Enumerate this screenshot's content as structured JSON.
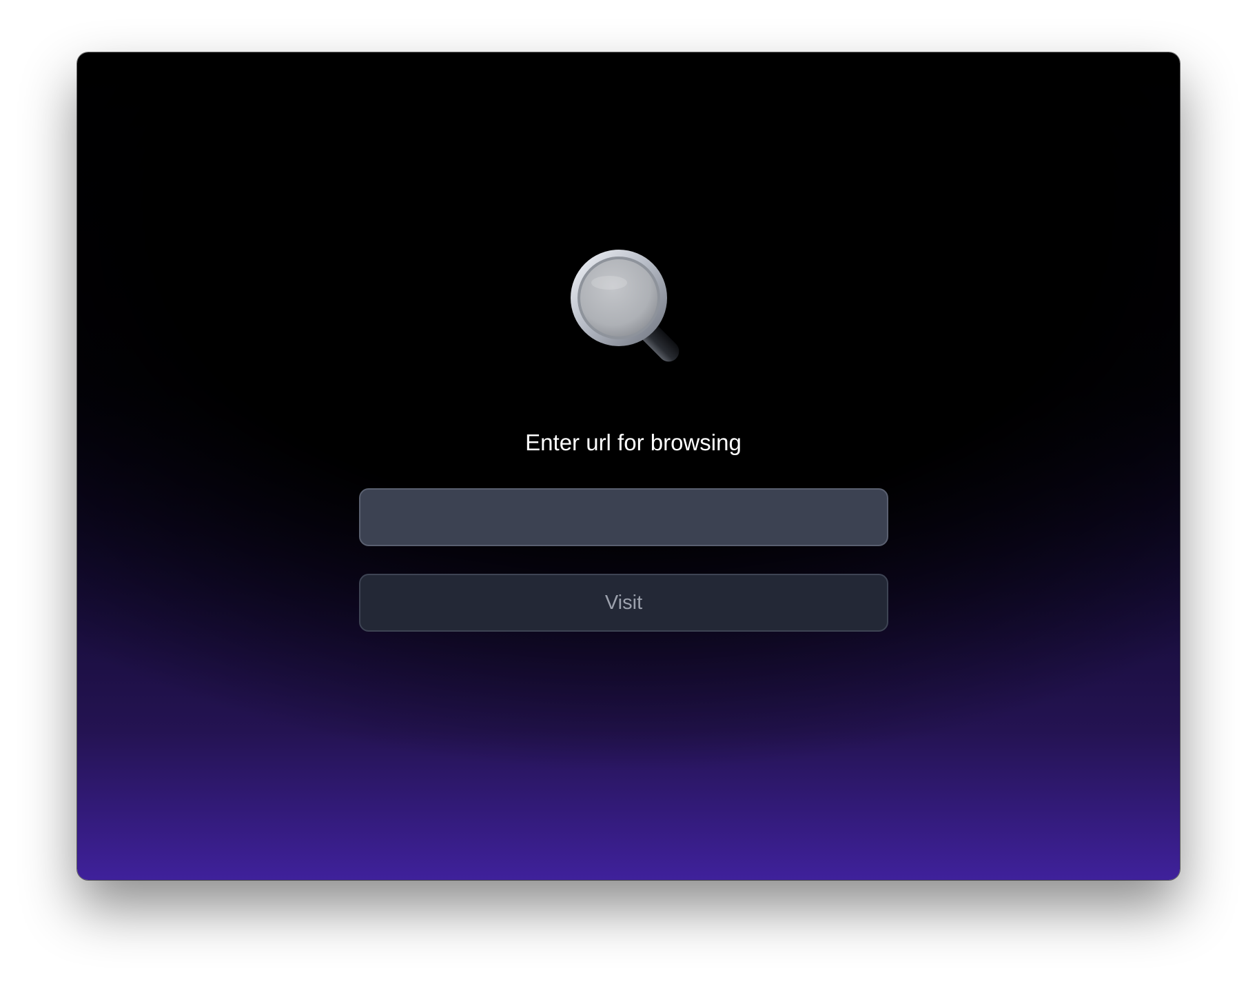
{
  "main": {
    "icon": "magnifying-glass-icon",
    "heading": "Enter url for browsing",
    "url_input": {
      "value": "",
      "placeholder": ""
    },
    "visit_label": "Visit"
  },
  "colors": {
    "gradient_top": "#000000",
    "gradient_bottom": "#3f219b",
    "input_background": "#3c4252",
    "button_background": "#232836",
    "button_text": "#9ca1ad",
    "heading_text": "#ffffff"
  }
}
